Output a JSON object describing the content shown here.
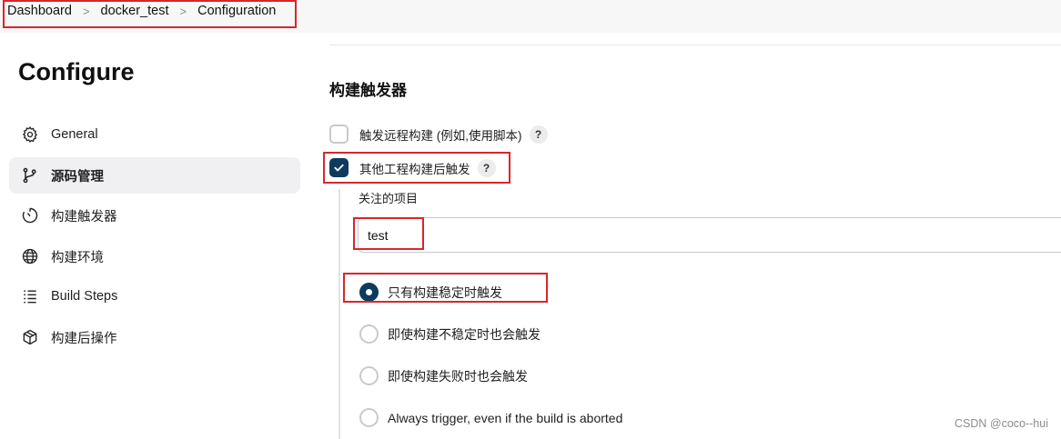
{
  "breadcrumb": {
    "items": [
      "Dashboard",
      "docker_test",
      "Configuration"
    ],
    "separator": ">"
  },
  "sidebar": {
    "title": "Configure",
    "items": [
      {
        "label": "General",
        "icon": "gear-icon",
        "active": false
      },
      {
        "label": "源码管理",
        "icon": "branch-icon",
        "active": true
      },
      {
        "label": "构建触发器",
        "icon": "timer-icon",
        "active": false
      },
      {
        "label": "构建环境",
        "icon": "globe-icon",
        "active": false
      },
      {
        "label": "Build Steps",
        "icon": "list-icon",
        "active": false
      },
      {
        "label": "构建后操作",
        "icon": "package-icon",
        "active": false
      }
    ]
  },
  "main": {
    "section_title": "构建触发器",
    "triggers": [
      {
        "label": "触发远程构建 (例如,使用脚本)",
        "checked": false,
        "help": "?"
      },
      {
        "label": "其他工程构建后触发",
        "checked": true,
        "help": "?"
      }
    ],
    "watched_projects": {
      "label": "关注的项目",
      "value": "test"
    },
    "trigger_conditions": [
      {
        "label": "只有构建稳定时触发",
        "selected": true
      },
      {
        "label": "即使构建不稳定时也会触发",
        "selected": false
      },
      {
        "label": "即使构建失败时也会触发",
        "selected": false
      },
      {
        "label": "Always trigger, even if the build is aborted",
        "selected": false
      }
    ]
  },
  "watermark": "CSDN @coco--hui",
  "colors": {
    "accent": "#0e3a5d",
    "highlight_box": "#d9262b",
    "active_nav_bg": "#f0f0f3"
  }
}
